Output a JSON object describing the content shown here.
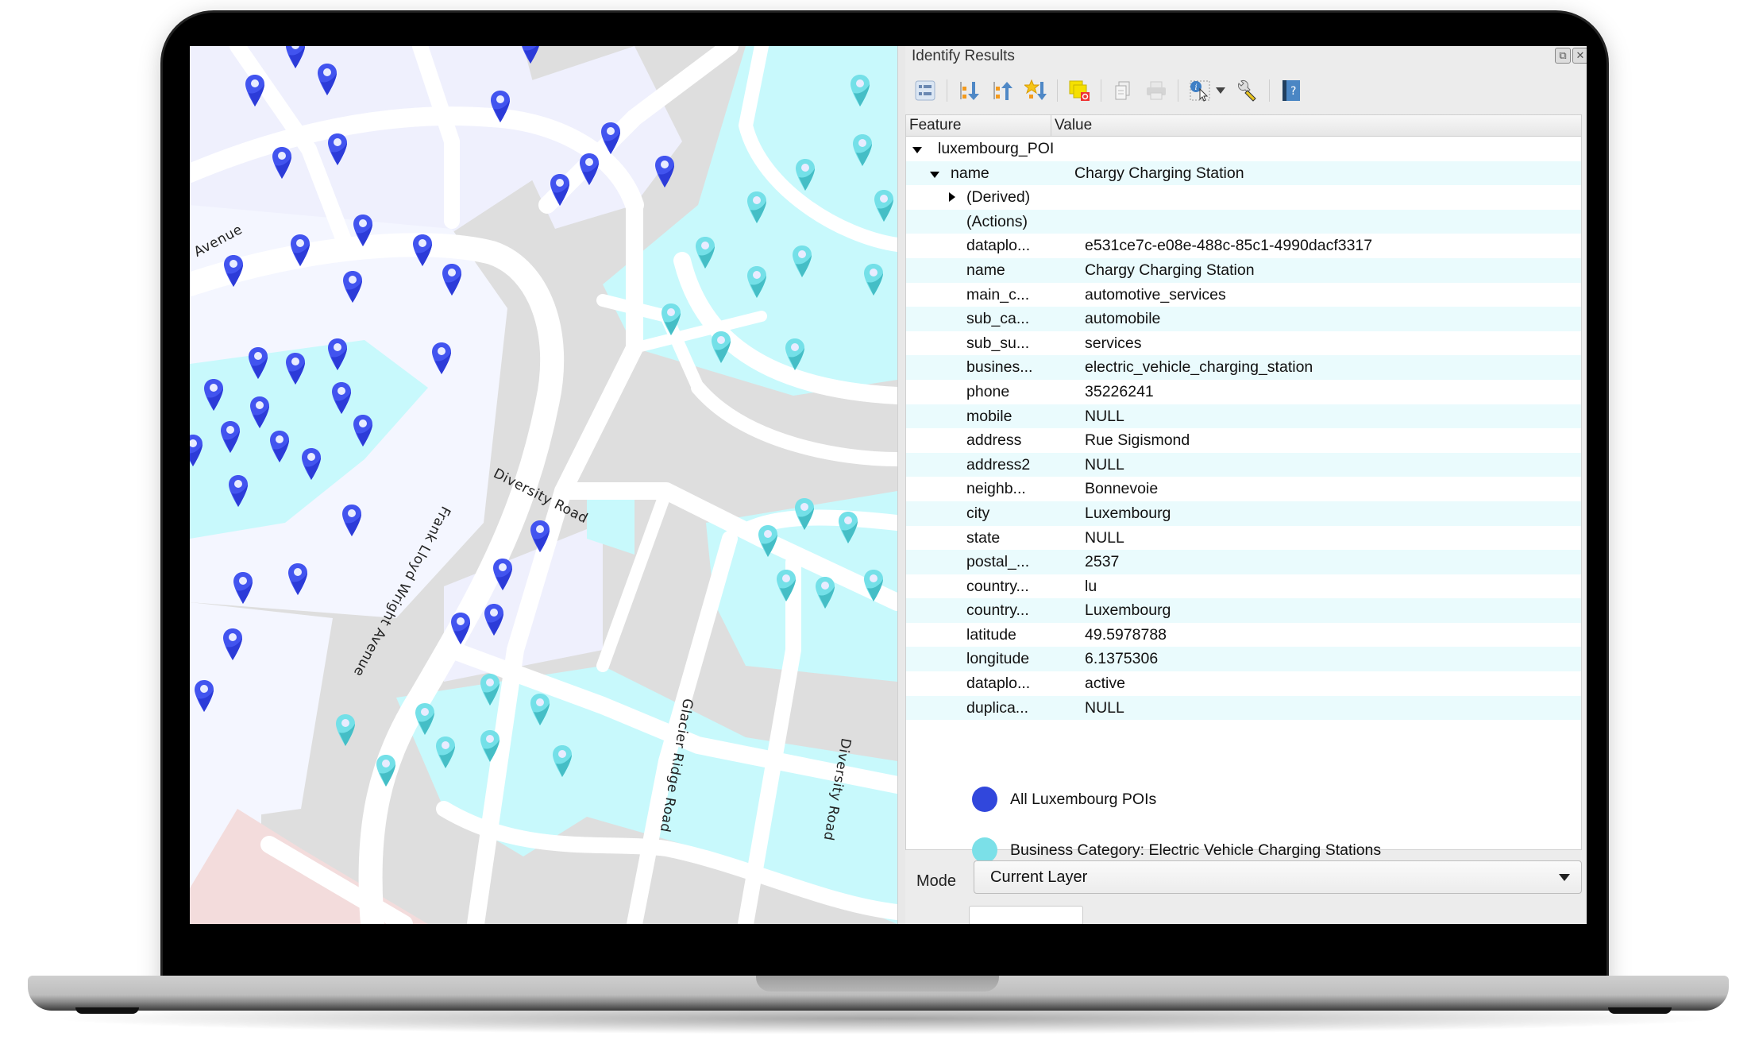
{
  "colors": {
    "poi_blue": "#3a4ee6",
    "ev_cyan": "#76e0e8",
    "row_alt": "#eafbfd"
  },
  "map": {
    "road_labels": [
      "Avenue",
      "Diversity Road",
      "Frank Lloyd Wright Avenue",
      "Glacier Ridge Road",
      "Diversity Road"
    ]
  },
  "panel": {
    "title": "Identify Results",
    "window_buttons": {
      "float": "⧉",
      "close": "✕"
    },
    "toolbar": [
      {
        "icon": "expand-tree-icon"
      },
      {
        "icon": "expand-all-icon"
      },
      {
        "icon": "collapse-all-icon"
      },
      {
        "icon": "expand-new-results-icon"
      },
      {
        "icon": "clear-results-icon"
      },
      {
        "icon": "copy-feature-icon"
      },
      {
        "icon": "print-icon"
      },
      {
        "icon": "identify-select-icon"
      },
      {
        "icon": "settings-wrench-icon"
      },
      {
        "icon": "help-icon"
      }
    ],
    "columns": {
      "feature": "Feature",
      "value": "Value"
    },
    "layer": "luxembourg_POI",
    "feature_key": "name",
    "feature_value": "Chargy Charging Station",
    "derived": "(Derived)",
    "actions": "(Actions)",
    "attributes": [
      {
        "key": "dataplo...",
        "value": "e531ce7c-e08e-488c-85c1-4990dacf3317"
      },
      {
        "key": "name",
        "value": "Chargy Charging Station"
      },
      {
        "key": "main_c...",
        "value": "automotive_services"
      },
      {
        "key": "sub_ca...",
        "value": "automobile"
      },
      {
        "key": "sub_su...",
        "value": "services"
      },
      {
        "key": "busines...",
        "value": "electric_vehicle_charging_station"
      },
      {
        "key": "phone",
        "value": "35226241"
      },
      {
        "key": "mobile",
        "value": "NULL"
      },
      {
        "key": "address",
        "value": "Rue Sigismond"
      },
      {
        "key": "address2",
        "value": "NULL"
      },
      {
        "key": "neighb...",
        "value": "Bonnevoie"
      },
      {
        "key": "city",
        "value": "Luxembourg"
      },
      {
        "key": "state",
        "value": "NULL"
      },
      {
        "key": "postal_...",
        "value": "2537"
      },
      {
        "key": "country...",
        "value": "lu"
      },
      {
        "key": "country...",
        "value": "Luxembourg"
      },
      {
        "key": "latitude",
        "value": "49.5978788"
      },
      {
        "key": "longitude",
        "value": "6.1375306"
      },
      {
        "key": "dataplo...",
        "value": "active"
      },
      {
        "key": "duplica...",
        "value": "NULL"
      }
    ],
    "legend": [
      {
        "label": "All Luxembourg POIs",
        "color": "#3147dc"
      },
      {
        "label": "Business Category: Electric Vehicle Charging Stations",
        "color": "#7be0e8"
      }
    ],
    "mode": {
      "label": "Mode",
      "value": "Current Layer"
    }
  }
}
